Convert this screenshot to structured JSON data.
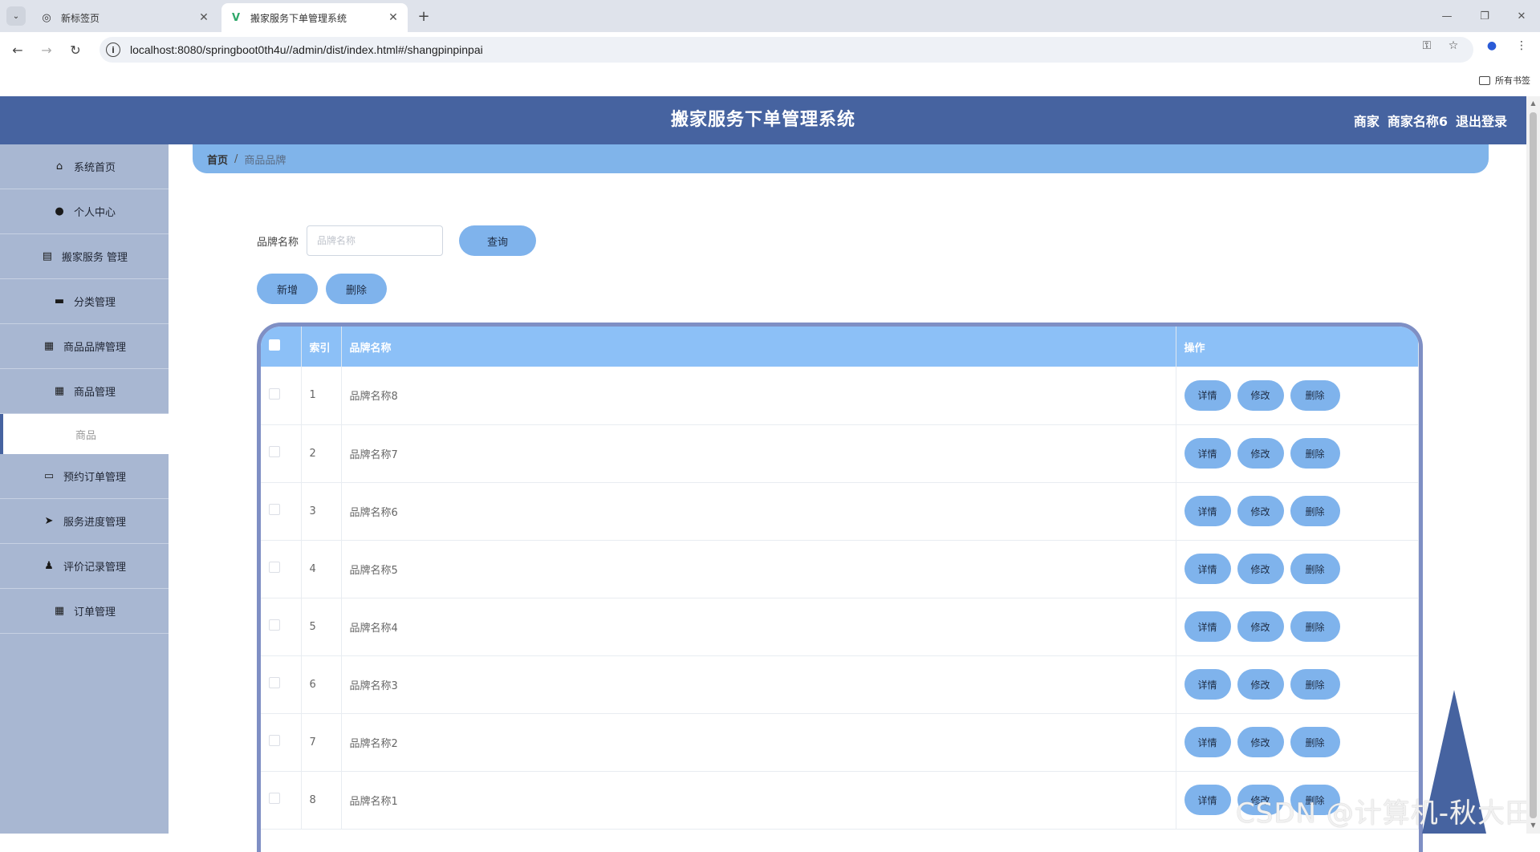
{
  "browser": {
    "tabs": [
      {
        "title": "新标签页",
        "active": false
      },
      {
        "title": "搬家服务下单管理系统",
        "active": true
      }
    ],
    "url": "localhost:8080/springboot0th4u//admin/dist/index.html#/shangpinpinpai",
    "bookmarks_label": "所有书签"
  },
  "header": {
    "title": "搬家服务下单管理系统",
    "role": "商家",
    "username": "商家名称6",
    "logout": "退出登录"
  },
  "sidebar": {
    "items": [
      {
        "label": "系统首页",
        "icon": "home-icon"
      },
      {
        "label": "个人中心",
        "icon": "user-icon"
      },
      {
        "label": "搬家服务 管理",
        "icon": "clipboard-icon"
      },
      {
        "label": "分类管理",
        "icon": "chat-icon"
      },
      {
        "label": "商品品牌管理",
        "icon": "grid-icon"
      },
      {
        "label": "商品管理",
        "icon": "grid-icon"
      },
      {
        "label": "预约订单管理",
        "icon": "monitor-icon"
      },
      {
        "label": "服务进度管理",
        "icon": "send-icon"
      },
      {
        "label": "评价记录管理",
        "icon": "person-icon"
      },
      {
        "label": "订单管理",
        "icon": "grid-icon"
      }
    ],
    "submenu": "商品"
  },
  "breadcrumb": {
    "home": "首页",
    "separator": "/",
    "current": "商品品牌"
  },
  "search": {
    "label": "品牌名称",
    "placeholder": "品牌名称",
    "value": "",
    "button": "查询"
  },
  "actions": {
    "add": "新增",
    "delete": "删除"
  },
  "table": {
    "columns": [
      "索引",
      "品牌名称",
      "操作"
    ],
    "rows": [
      {
        "index": "1",
        "name": "品牌名称8"
      },
      {
        "index": "2",
        "name": "品牌名称7"
      },
      {
        "index": "3",
        "name": "品牌名称6"
      },
      {
        "index": "4",
        "name": "品牌名称5"
      },
      {
        "index": "5",
        "name": "品牌名称4"
      },
      {
        "index": "6",
        "name": "品牌名称3"
      },
      {
        "index": "7",
        "name": "品牌名称2"
      },
      {
        "index": "8",
        "name": "品牌名称1"
      }
    ],
    "row_actions": {
      "detail": "详情",
      "edit": "修改",
      "delete": "删除"
    }
  },
  "watermark": "CSDN @计算机-秋大田",
  "colors": {
    "header": "#4663a0",
    "sidebar": "#a8b7d2",
    "button": "#7fb3ec",
    "table_head": "#8cc0f7",
    "breadcrumb": "#80b4ea"
  }
}
